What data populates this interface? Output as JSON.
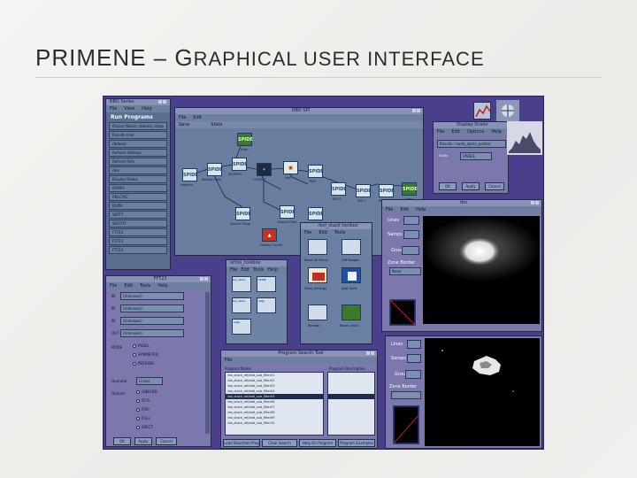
{
  "slide": {
    "title_part1": "PRIMENE – G",
    "title_part2": "RAPHICAL USER INTERFACE"
  },
  "run_programs": {
    "title": "RBO Series",
    "menu": [
      "File",
      "View",
      "Help"
    ],
    "heading": "Run Programs",
    "rows": [
      "Project Name: rbdemo_stage",
      "Results User",
      "rbdemo",
      "Refresh Settings",
      "Refresh Refs",
      "rbol",
      "Display Status",
      "RAPIFA",
      "RBLCFAC",
      "DEPN",
      "SEPTT",
      "SEXTOT",
      "FTT22",
      "FTT23",
      "FTT24"
    ]
  },
  "flow": {
    "title": "RBO SPI",
    "menu": [
      "File",
      "Edit"
    ],
    "toolbar": [
      "Save",
      "Stats"
    ],
    "node_text": "SPIDE",
    "labels": [
      "rbdemo",
      "Refresh Refs",
      "MUGRPC",
      "COROSC",
      "align",
      "RBS",
      "Search Filter",
      "Search Filter",
      "SE0.1",
      "SE0.7",
      "rbol",
      "Search Setup",
      "SELT17",
      "align",
      "Display Center"
    ]
  },
  "scale_win": {
    "title": "Display Scaler",
    "menu": [
      "File",
      "Edit",
      "Options",
      "Help"
    ],
    "line1": "Results: rrweb_alpha_pointer",
    "stride_label": "Stride",
    "stride_value": "VISBLE",
    "buttons": [
      "OK",
      "Apply",
      "Cancel"
    ]
  },
  "big_viewer": {
    "title": "rbo",
    "menu": [
      "File",
      "Edit",
      "Help"
    ],
    "fields": [
      "Lines",
      "Samps",
      "Group",
      "Zone Border"
    ],
    "zoom_value": "None"
  },
  "toolbox_small": {
    "title": "ortho_toolbox",
    "menu": [
      "File",
      "Edit",
      "Tools",
      "Help"
    ],
    "labels": [
      "rbol_stack",
      "SPIDE",
      "rbol_stack",
      "align",
      "align"
    ]
  },
  "toolbox_large": {
    "title": "rbol_stack toolbox",
    "menu": [
      "File",
      "Edit",
      "Tools"
    ],
    "labels": [
      "Reset All Filters",
      "Diff Ranges",
      "Fixed_Settings",
      "Split Tools",
      "Blender",
      "Reset Limits"
    ]
  },
  "fft_win": {
    "title": "FFT22",
    "menu": [
      "File",
      "Edit",
      "Tools",
      "Help"
    ],
    "rows": [
      {
        "label": "IN",
        "value": "(Unknown)"
      },
      {
        "label": "IN",
        "value": "(Unknown)"
      },
      {
        "label": "IN",
        "value": "(Unknown)"
      },
      {
        "label": "OUT",
        "value": "(Unknown)"
      }
    ],
    "mode_label": "MODE",
    "modes": [
      "PSDEL",
      "SYMMETRIC",
      "PERIODIC"
    ],
    "operator_label": "Operator",
    "operator_value": "Linear",
    "options_label": "Options",
    "options": [
      "LINEARD",
      "STYL",
      "FRIP",
      "FULL",
      "SPECT"
    ],
    "buttons": [
      "OK",
      "Apply",
      "Cancel"
    ]
  },
  "prog_list": {
    "title": "Program Search Tool",
    "menu": [
      "File"
    ],
    "col1": "Program Name",
    "col2": "Program Description",
    "items": [
      "rbo_stack_ref/add_sub_filter01",
      "rbo_stack_ref/add_sub_filter02",
      "rbo_stack_ref/add_sub_filter03",
      "rbo_stack_ref/add_sub_filter04",
      "rbo_stack_ref/add_sub_filter05",
      "rbo_stack_ref/add_sub_filter06",
      "rbo_stack_ref/add_sub_filter07",
      "rbo_stack_ref/add_sub_filter08",
      "rbo_stack_ref/add_sub_filter09",
      "rbo_stack_ref/add_sub_filter10"
    ],
    "selected_index": 4,
    "buttons": [
      "Load Searched Prog",
      "Clear Search",
      "Help On Program",
      "Program Examples"
    ]
  },
  "small_viewer": {
    "fields": [
      "Lines",
      "Samps",
      "Group",
      "Zone Border"
    ]
  }
}
